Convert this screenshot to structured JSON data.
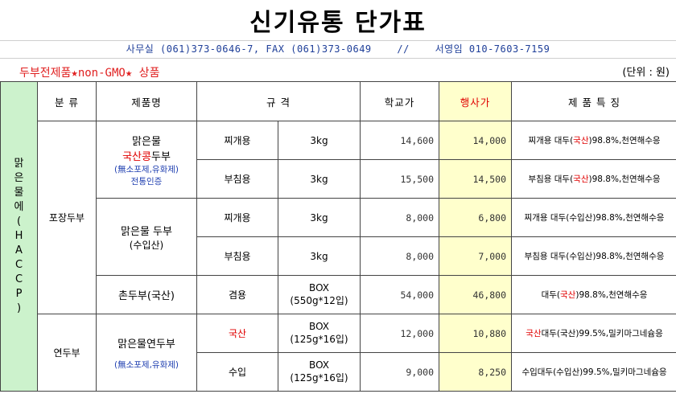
{
  "title": "신기유통  단가표",
  "contact": {
    "office": "사무실 (061)373-0646-7, FAX (061)373-0649",
    "sep": "//",
    "person": "서영임 010-7603-7159"
  },
  "product_line": "두부전제품★non-GMO★ 상품",
  "unit": "(단위 : 원)",
  "headers": {
    "category": "분 류",
    "product": "제품명",
    "spec": "규 격",
    "school_price": "학교가",
    "event_price": "행사가",
    "features": "제   품   특   징"
  },
  "side_chars": [
    "맑",
    "은",
    "물",
    "에",
    "(",
    "H",
    "A",
    "C",
    "C",
    "P",
    ")"
  ],
  "groups": [
    {
      "category": "포장두부",
      "products": [
        {
          "name_lines": [
            "맑은물"
          ],
          "name_red_part": "국산콩",
          "name_black_part": "두부",
          "sub_lines": [
            "(無소포제,유화제)",
            "전통인증"
          ],
          "rows": [
            {
              "spec1": "찌개용",
              "spec2": "3kg",
              "school": "14,600",
              "event": "14,000",
              "feat_pre": "찌개용 대두(",
              "feat_red": "국산",
              "feat_post": ")98.8%,천연해수응"
            },
            {
              "spec1": "부침용",
              "spec2": "3kg",
              "school": "15,500",
              "event": "14,500",
              "feat_pre": "부침용 대두(",
              "feat_red": "국산",
              "feat_post": ")98.8%,천연해수응"
            }
          ]
        },
        {
          "name_lines": [
            "맑은물 두부",
            "(수입산)"
          ],
          "rows": [
            {
              "spec1": "찌개용",
              "spec2": "3kg",
              "school": "8,000",
              "event": "6,800",
              "feat": "찌개용 대두(수입산)98.8%,천연해수응"
            },
            {
              "spec1": "부침용",
              "spec2": "3kg",
              "school": "8,000",
              "event": "7,000",
              "feat": "부침용 대두(수입산)98.8%,천연해수응"
            }
          ]
        },
        {
          "name_lines": [
            "촌두부(국산)"
          ],
          "rows": [
            {
              "spec1": "겸용",
              "spec2_lines": [
                "BOX",
                "(550g*12입)"
              ],
              "school": "54,000",
              "event": "46,800",
              "feat_pre": "대두(",
              "feat_red": "국산",
              "feat_post": ")98.8%,천연해수응"
            }
          ]
        }
      ]
    },
    {
      "category": "연두부",
      "products": [
        {
          "name_lines": [
            "맑은물연두부"
          ],
          "sub_lines": [
            "(無소포제,유화제)"
          ],
          "rows": [
            {
              "spec1": "국산",
              "spec2_lines": [
                "BOX",
                "(125g*16입)"
              ],
              "school": "12,000",
              "event": "10,880",
              "feat_red": "국산",
              "feat_post": "대두(국산)99.5%,밀키마그네슘응"
            },
            {
              "spec1": "수입",
              "spec2_lines": [
                "BOX",
                "(125g*16입)"
              ],
              "school": "9,000",
              "event": "8,250",
              "feat": "수입대두(수입산)99.5%,밀키마그네슘응"
            }
          ]
        }
      ]
    }
  ]
}
